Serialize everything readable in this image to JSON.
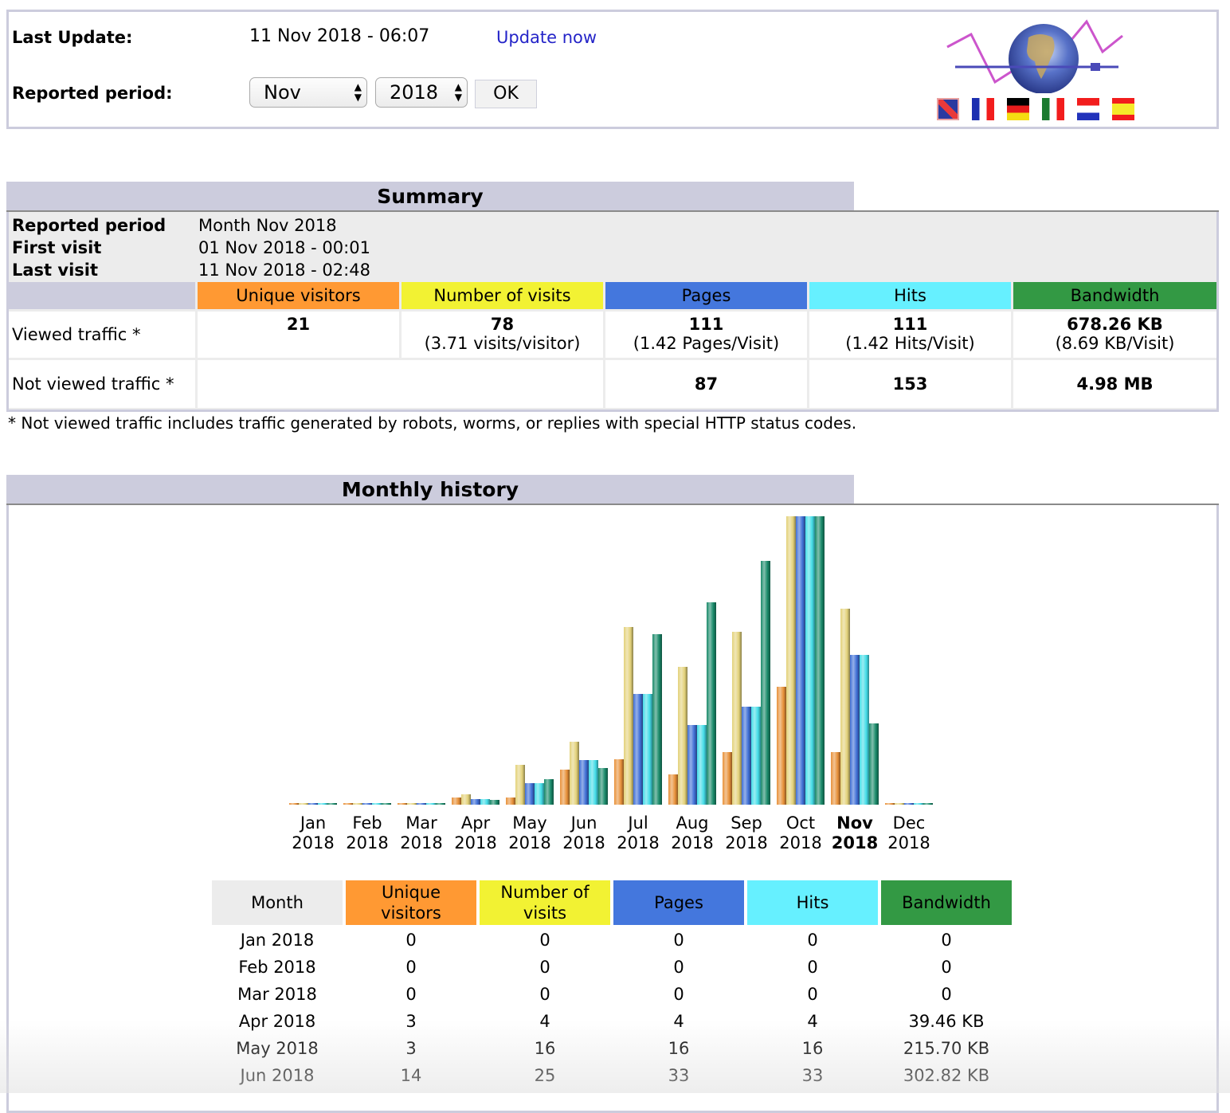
{
  "header": {
    "last_update_label": "Last Update:",
    "last_update_value": "11 Nov 2018 - 06:07",
    "update_now_link": "Update now",
    "reported_period_label": "Reported period:",
    "month_select": "Nov",
    "year_select": "2018",
    "ok_button": "OK",
    "logo_icon": "awstats-globe-logo-icon",
    "flags": [
      {
        "name": "english-flag-icon",
        "colors": [
          "#2a3aa0",
          "#e83a3a",
          "#ffffff"
        ]
      },
      {
        "name": "french-flag-icon",
        "colors": [
          "#1c2fb0",
          "#ffffff",
          "#f21d1d"
        ]
      },
      {
        "name": "german-flag-icon",
        "colors": [
          "#000000",
          "#e81c1c",
          "#f5dc12"
        ]
      },
      {
        "name": "italian-flag-icon",
        "colors": [
          "#1c7a30",
          "#ffffff",
          "#f21d1d"
        ]
      },
      {
        "name": "dutch-flag-icon",
        "colors": [
          "#f21d1d",
          "#ffffff",
          "#2233bb"
        ]
      },
      {
        "name": "spanish-flag-icon",
        "colors": [
          "#f21d1d",
          "#f5ea2a",
          "#f21d1d"
        ]
      }
    ]
  },
  "summary": {
    "title": "Summary",
    "reported_period_label": "Reported period",
    "reported_period_value": "Month Nov 2018",
    "first_visit_label": "First visit",
    "first_visit_value": "01 Nov 2018 - 00:01",
    "last_visit_label": "Last visit",
    "last_visit_value": "11 Nov 2018 - 02:48",
    "columns": [
      {
        "label": "Unique visitors",
        "color": "#ff9933"
      },
      {
        "label": "Number of visits",
        "color": "#f2f233"
      },
      {
        "label": "Pages",
        "color": "#4477dd"
      },
      {
        "label": "Hits",
        "color": "#66f0ff"
      },
      {
        "label": "Bandwidth",
        "color": "#339944"
      }
    ],
    "viewed_label": "Viewed traffic *",
    "viewed": [
      {
        "value": "21",
        "sub": ""
      },
      {
        "value": "78",
        "sub": "(3.71 visits/visitor)"
      },
      {
        "value": "111",
        "sub": "(1.42 Pages/Visit)"
      },
      {
        "value": "111",
        "sub": "(1.42 Hits/Visit)"
      },
      {
        "value": "678.26 KB",
        "sub": "(8.69 KB/Visit)"
      }
    ],
    "not_viewed_label": "Not viewed traffic *",
    "not_viewed": {
      "pages": "87",
      "hits": "153",
      "bandwidth": "4.98 MB"
    },
    "footnote": "* Not viewed traffic includes traffic generated by robots, worms, or replies with special HTTP status codes."
  },
  "monthly": {
    "title": "Monthly history",
    "table_headers": [
      "Month",
      "Unique visitors",
      "Number of visits",
      "Pages",
      "Hits",
      "Bandwidth"
    ],
    "table_header_colors": [
      "#ececec",
      "#ff9933",
      "#f2f233",
      "#4477dd",
      "#66f0ff",
      "#339944"
    ],
    "rows": [
      [
        "Jan 2018",
        "0",
        "0",
        "0",
        "0",
        "0"
      ],
      [
        "Feb 2018",
        "0",
        "0",
        "0",
        "0",
        "0"
      ],
      [
        "Mar 2018",
        "0",
        "0",
        "0",
        "0",
        "0"
      ],
      [
        "Apr 2018",
        "3",
        "4",
        "4",
        "4",
        "39.46 KB"
      ],
      [
        "May 2018",
        "3",
        "16",
        "16",
        "16",
        "215.70 KB"
      ],
      [
        "Jun 2018",
        "14",
        "25",
        "33",
        "33",
        "302.82 KB"
      ]
    ]
  },
  "chart_data": {
    "type": "bar",
    "title": "Monthly history",
    "categories": [
      "Jan 2018",
      "Feb 2018",
      "Mar 2018",
      "Apr 2018",
      "May 2018",
      "Jun 2018",
      "Jul 2018",
      "Aug 2018",
      "Sep 2018",
      "Oct 2018",
      "Nov 2018",
      "Dec 2018"
    ],
    "month_labels": [
      "Jan",
      "Feb",
      "Mar",
      "Apr",
      "May",
      "Jun",
      "Jul",
      "Aug",
      "Sep",
      "Oct",
      "Nov",
      "Dec"
    ],
    "year_label": "2018",
    "highlighted_category": "Nov 2018",
    "xlabel": "",
    "ylabel": "",
    "grid": false,
    "legend": "none",
    "series": [
      {
        "name": "Unique visitors",
        "color": "#e8913a",
        "scale_group": "visits",
        "values": [
          0,
          0,
          0,
          3,
          3,
          14,
          18,
          12,
          21,
          47,
          21,
          0
        ]
      },
      {
        "name": "Number of visits",
        "color": "#e3d27a",
        "scale_group": "visits",
        "values": [
          0,
          0,
          0,
          4,
          16,
          25,
          71,
          55,
          69,
          115,
          78,
          0
        ]
      },
      {
        "name": "Pages",
        "color": "#3f6fd6",
        "scale_group": "hits",
        "values": [
          0,
          0,
          0,
          4,
          16,
          33,
          82,
          59,
          73,
          214,
          111,
          0
        ]
      },
      {
        "name": "Hits",
        "color": "#45dde8",
        "scale_group": "hits",
        "values": [
          0,
          0,
          0,
          4,
          16,
          33,
          82,
          59,
          73,
          214,
          111,
          0
        ]
      },
      {
        "name": "Bandwidth (KB)",
        "color": "#1a8a6a",
        "scale_group": "bandwidth",
        "values": [
          0,
          0,
          0,
          39.46,
          215.7,
          302.82,
          1420,
          1690,
          2030,
          2405,
          678.26,
          0
        ]
      }
    ],
    "scale_max": {
      "visits": 115,
      "hits": 214,
      "bandwidth": 2405
    }
  }
}
